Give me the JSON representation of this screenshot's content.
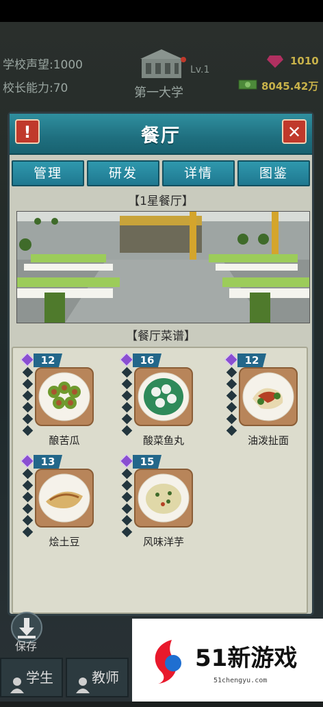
{
  "top_stats": {
    "reputation_label": "学校声望:",
    "reputation_value": "1000",
    "ability_label": "校长能力:",
    "ability_value": "70",
    "university_name": "第一大学",
    "level": "Lv.1",
    "gems": "1010",
    "money": "8045.42万"
  },
  "panel": {
    "title": "餐厅",
    "alert_icon": "!",
    "close_icon": "✕"
  },
  "tabs": [
    {
      "label": "管理"
    },
    {
      "label": "研发"
    },
    {
      "label": "详情"
    },
    {
      "label": "图鉴"
    }
  ],
  "restaurant_level_title": "【1星餐厅】",
  "menu_title": "【餐厅菜谱】",
  "dishes": [
    {
      "name": "酿苦瓜",
      "count": "12",
      "food_color": "#6f9a2e"
    },
    {
      "name": "酸菜鱼丸",
      "count": "16",
      "food_color": "#2f8a5a"
    },
    {
      "name": "油泼扯面",
      "count": "12",
      "food_color": "#b54025"
    },
    {
      "name": "烩土豆",
      "count": "13",
      "food_color": "#d9b26a"
    },
    {
      "name": "风味洋芋",
      "count": "15",
      "food_color": "#e0d8a8"
    }
  ],
  "bottom": {
    "save_label": "保存",
    "tab_students": "学生",
    "tab_teachers": "教师"
  },
  "watermark": {
    "name": "51新游戏",
    "url": "51chengyu.com"
  }
}
